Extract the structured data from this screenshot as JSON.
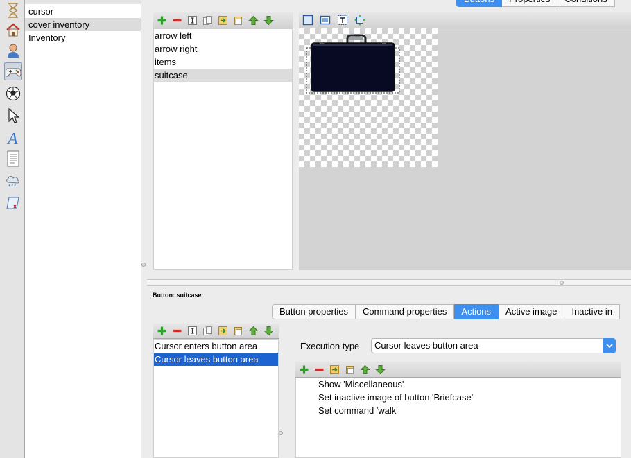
{
  "sidebar_icons": [
    {
      "name": "hourglass-icon"
    },
    {
      "name": "house-icon"
    },
    {
      "name": "person-icon"
    },
    {
      "name": "gamepad-icon",
      "selected": true
    },
    {
      "name": "soccer-ball-icon"
    },
    {
      "name": "arrow-cursor-icon"
    },
    {
      "name": "font-a-icon"
    },
    {
      "name": "document-icon"
    },
    {
      "name": "weather-cloud-icon"
    },
    {
      "name": "script-scroll-icon"
    }
  ],
  "left_list": {
    "items": [
      "cursor",
      "cover inventory",
      "Inventory"
    ],
    "selected_index": 1
  },
  "top_tabs": {
    "items": [
      "Buttons",
      "Properties",
      "Conditions"
    ],
    "active_index": 0
  },
  "upper_toolbar": {
    "icons": [
      "add-icon",
      "remove-icon",
      "rename-icon",
      "copy-icon",
      "export-icon",
      "paste-icon",
      "move-up-icon",
      "move-down-icon"
    ]
  },
  "button_list": {
    "items": [
      "arrow left",
      "arrow right",
      "items",
      "suitcase"
    ],
    "selected_index": 3
  },
  "image_toolbar": {
    "icons": [
      "select-rect-icon",
      "image-view-icon",
      "text-frame-icon",
      "fit-view-icon"
    ]
  },
  "selection_label": "Button: suitcase",
  "bottom_tabs": {
    "items": [
      "Button properties",
      "Command properties",
      "Actions",
      "Active image",
      "Inactive in"
    ],
    "active_index": 2
  },
  "action_list": {
    "items": [
      "Cursor enters button area",
      "Cursor leaves button area"
    ],
    "selected_index": 1
  },
  "execution": {
    "label": "Execution type",
    "value": "Cursor leaves button area"
  },
  "commands": {
    "items": [
      "Show 'Miscellaneous'",
      "Set inactive image of button 'Briefcase'",
      "Set command 'walk'"
    ]
  },
  "colors": {
    "accent": "#3d8ff0",
    "selection": "#1e63d2"
  }
}
